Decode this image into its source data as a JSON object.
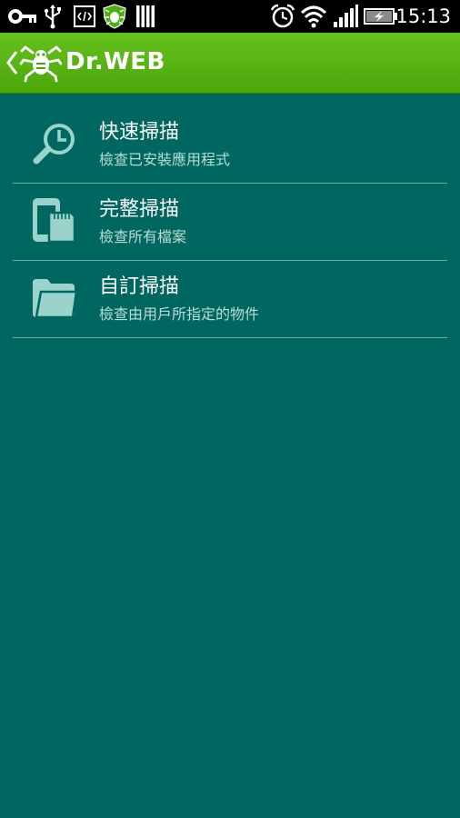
{
  "status_bar": {
    "time": "15:13",
    "icons": [
      "key-icon",
      "usb-icon",
      "developer-icon",
      "drweb-shield-icon",
      "storage-icon",
      "alarm-icon",
      "wifi-icon",
      "signal-icon",
      "battery-charging-icon"
    ]
  },
  "action_bar": {
    "title": "Dr.WEB",
    "accent": "#5cb515"
  },
  "menu": {
    "items": [
      {
        "title": "快速掃描",
        "subtitle": "檢查已安裝應用程式",
        "icon": "quick-scan-icon"
      },
      {
        "title": "完整掃描",
        "subtitle": "檢查所有檔案",
        "icon": "full-scan-icon"
      },
      {
        "title": "自訂掃描",
        "subtitle": "檢查由用戶所指定的物件",
        "icon": "custom-scan-icon"
      }
    ]
  },
  "colors": {
    "background": "#006760",
    "icon": "#9ad3cb",
    "subtitle": "#b8dcd6"
  }
}
